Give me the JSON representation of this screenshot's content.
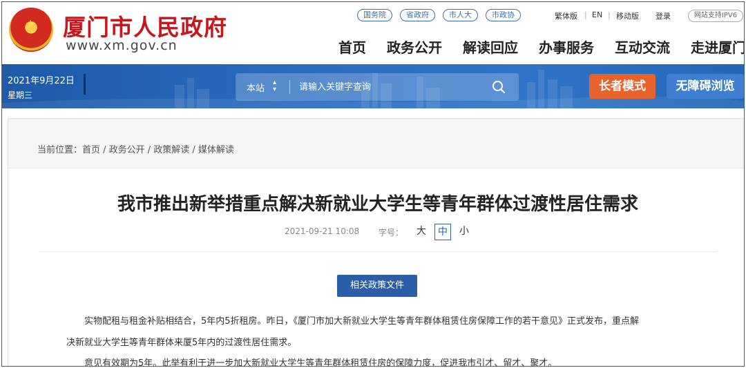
{
  "header": {
    "site_title": "厦门市人民政府",
    "site_url": "www.xm.gov.cn",
    "top_links": [
      "国务院",
      "省政府",
      "市人大",
      "市政协"
    ],
    "lang_traditional": "繁体版",
    "lang_sep": "|",
    "lang_en": "EN",
    "mobile": "移动版",
    "login": "登录",
    "ipv6": "网站支持IPV6",
    "nav": [
      "首页",
      "政务公开",
      "解读回应",
      "办事服务",
      "互动交流",
      "走进厦门"
    ]
  },
  "banner": {
    "date": "2021年9月22日",
    "weekday": "星期三",
    "search_scope": "本站",
    "search_placeholder": "请输入关键字查询",
    "elder_mode": "长者模式",
    "accessible": "无障碍浏览"
  },
  "article": {
    "breadcrumb": "当前位置：首页 / 政务公开 / 政策解读 / 媒体解读",
    "title": "我市推出新举措重点解决新就业大学生等青年群体过渡性居住需求",
    "date": "2021-09-21 10:08",
    "font_size_label": "字号：",
    "font_sizes": [
      "大",
      "中",
      "小"
    ],
    "policy_button": "相关政策文件",
    "paragraphs": [
      "实物配租与租金补贴相结合，5年内5折租房。昨日，《厦门市加大新就业大学生等青年群体租赁住房保障工作的若干意见》正式发布，重点解",
      "决新就业大学生等青年群体来厦5年内的过渡性居住需求。",
      "意见有效期为5年。此举有利于进一步加大新就业大学生等青年群体租赁住房的保障力度，促进我市引才、留才、聚才。"
    ]
  },
  "colors": {
    "brand_red": "#c8161d",
    "banner_blue": "#2a6cc0",
    "elder_orange": "#e8622c",
    "accessible_blue": "#3f7ed0",
    "policy_blue": "#2a5ea8"
  }
}
